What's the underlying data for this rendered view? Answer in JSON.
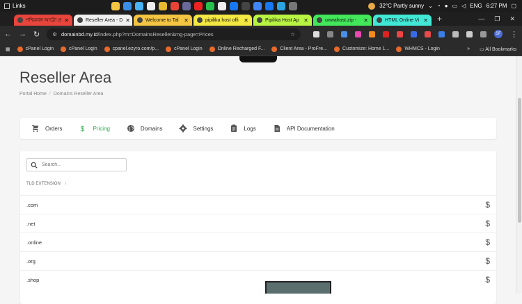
{
  "taskbar": {
    "links": "Links",
    "weather": "32°C  Partly sunny",
    "lang": "ENG",
    "time": "6:27 PM"
  },
  "tabs": [
    {
      "label": "পশ্চিমবঙ্গ আট্টো প্র",
      "color": "#e8453c"
    },
    {
      "label": "Reseller Area - D",
      "color": "#f0f0f0"
    },
    {
      "label": "Welcome to Tal",
      "color": "#f4c542"
    },
    {
      "label": "pipilika host offi",
      "color": "#f4e842"
    },
    {
      "label": "Pipilika Host Ap",
      "color": "#b8f442"
    },
    {
      "label": "unwahost.zip -",
      "color": "#42e85a"
    },
    {
      "label": "HTML Online Vi",
      "color": "#42e8d6"
    }
  ],
  "address": {
    "host": "domainbd.my.id",
    "path": "/index.php?m=DomainsReseller&mg-page=Prices"
  },
  "bookmarks": [
    "cPanel Login",
    "cPanel Login",
    "cpanel.ezyro.com/p...",
    "cPanel Login",
    "Online Recharged F...",
    "Client Area - ProFre...",
    "Customize: Home 1...",
    "WHMCS - Login"
  ],
  "all_bookmarks": "All Bookmarks",
  "page": {
    "title": "Reseller Area",
    "breadcrumb": [
      "Portal Home",
      "Domains Reseller Area"
    ]
  },
  "nav": [
    {
      "label": "Orders",
      "icon": "cart-icon"
    },
    {
      "label": "Pricing",
      "icon": "dollar-icon",
      "active": true
    },
    {
      "label": "Domains",
      "icon": "globe-icon"
    },
    {
      "label": "Settings",
      "icon": "gear-icon"
    },
    {
      "label": "Logs",
      "icon": "clipboard-icon"
    },
    {
      "label": "API Documentation",
      "icon": "document-icon"
    }
  ],
  "search": {
    "placeholder": "Search..."
  },
  "table": {
    "column": "TLD EXTENSION",
    "rows": [
      ".com",
      ".net",
      ".online",
      ".org",
      ".shop"
    ]
  },
  "colors": {
    "accent": "#2fa94e"
  }
}
